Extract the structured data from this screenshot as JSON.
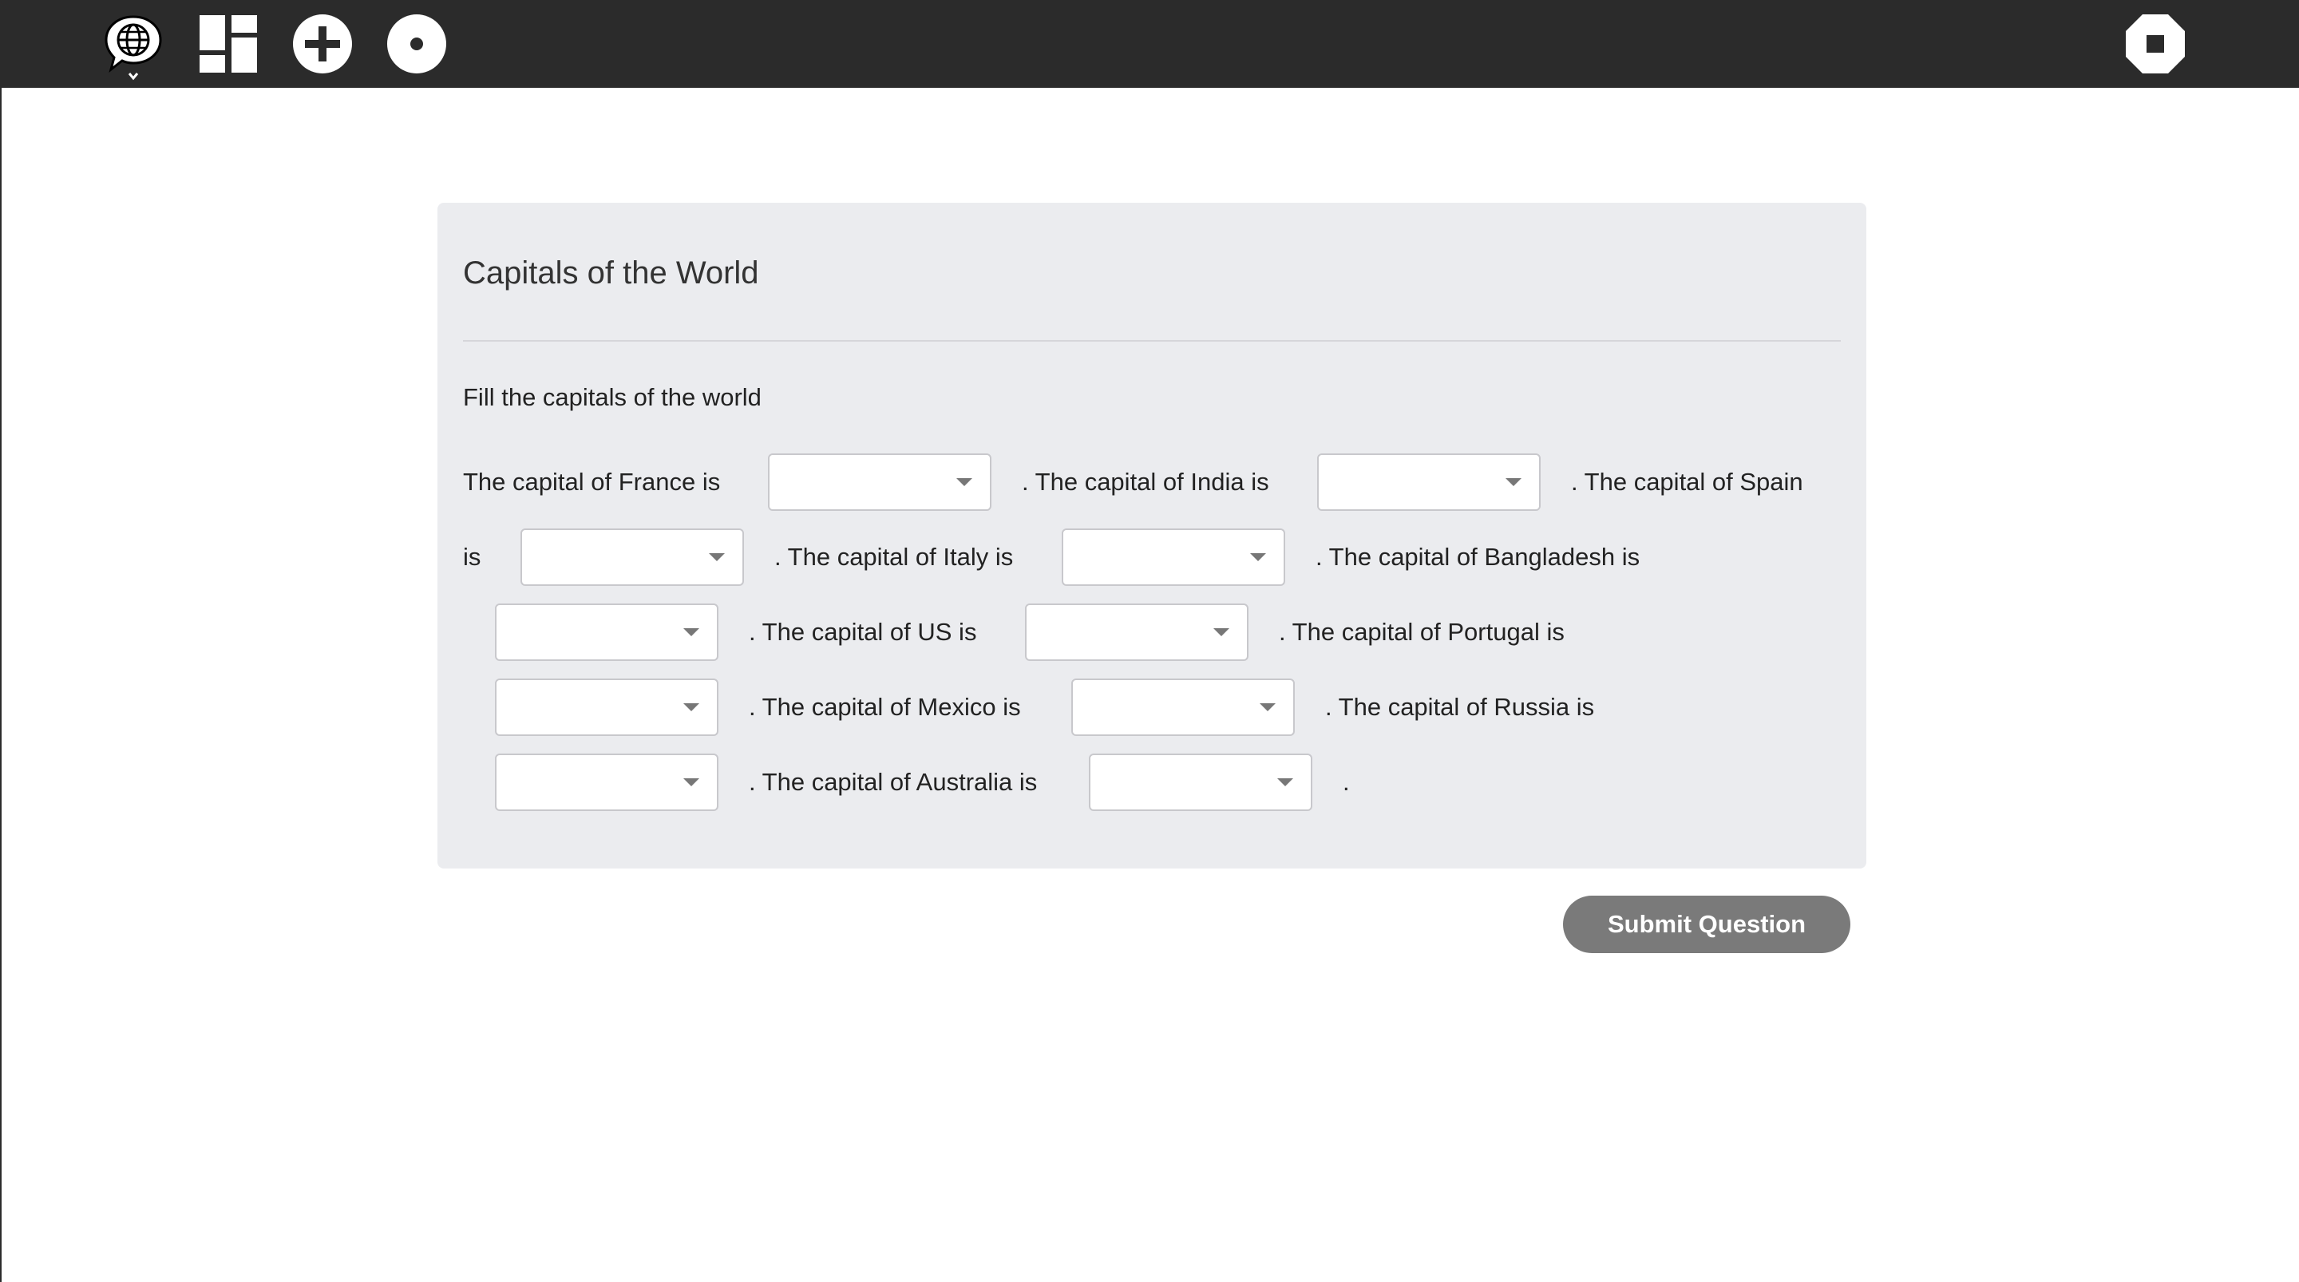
{
  "toolbar": {
    "icons": [
      "language-globe-icon",
      "grid-dashboard-icon",
      "add-icon",
      "record-icon",
      "stop-icon"
    ]
  },
  "question": {
    "title": "Capitals of the World",
    "instructions": "Fill the capitals of the world",
    "text_segments": [
      "The capital of France is",
      ". The capital of India is",
      ". The capital of Spain",
      "is",
      ". The capital of Italy is",
      ". The capital of Bangladesh is",
      ". The capital of US is",
      ". The capital of Portugal is",
      ". The capital of Mexico is",
      ". The capital of Russia is",
      ". The capital of Australia is",
      "."
    ],
    "dropdowns": [
      {
        "country": "France",
        "selected": ""
      },
      {
        "country": "India",
        "selected": ""
      },
      {
        "country": "Spain",
        "selected": ""
      },
      {
        "country": "Italy",
        "selected": ""
      },
      {
        "country": "Bangladesh",
        "selected": ""
      },
      {
        "country": "US",
        "selected": ""
      },
      {
        "country": "Portugal",
        "selected": ""
      },
      {
        "country": "Mexico",
        "selected": ""
      },
      {
        "country": "Russia",
        "selected": ""
      },
      {
        "country": "Australia",
        "selected": ""
      }
    ]
  },
  "submit": {
    "label": "Submit Question",
    "color": "#7a7a7a"
  },
  "colors": {
    "topbar": "#2b2b2b",
    "panel": "#ebecef"
  }
}
